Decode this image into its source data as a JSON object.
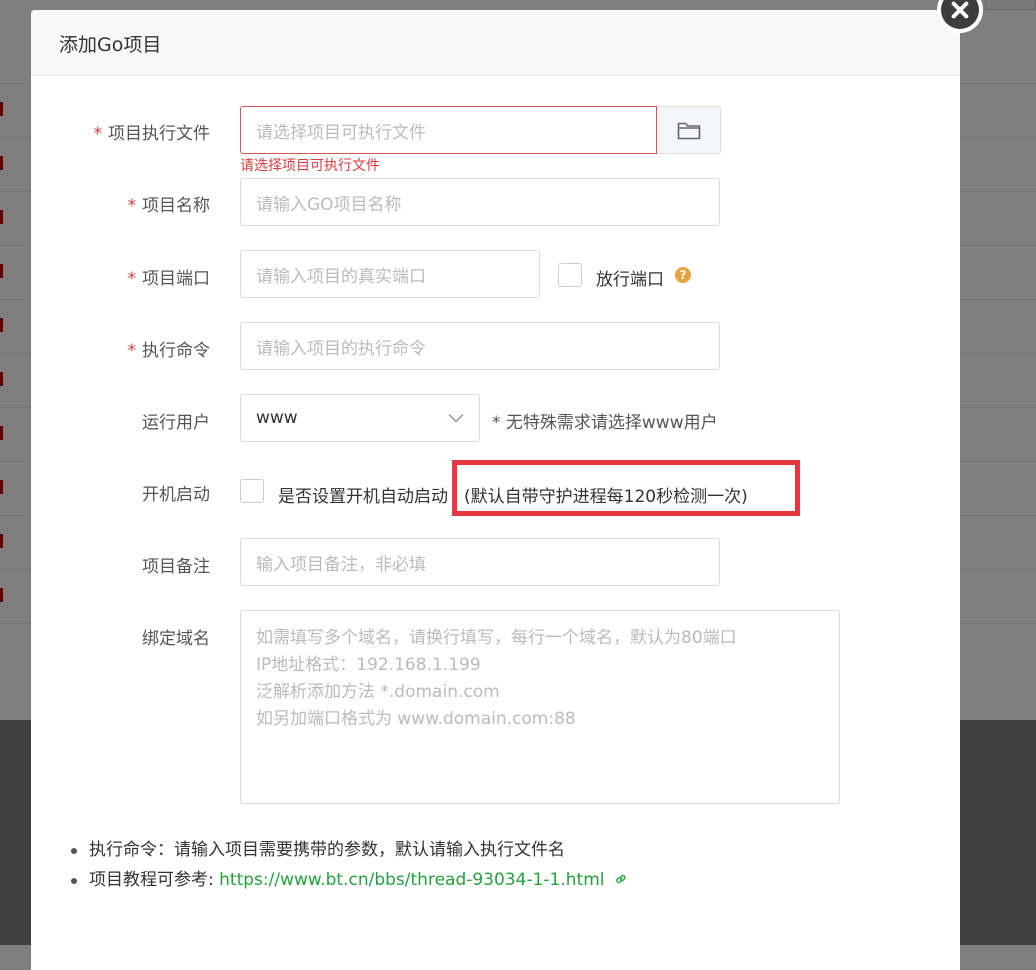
{
  "modal": {
    "title": "添加Go项目"
  },
  "form": {
    "exec_file": {
      "label": "项目执行文件",
      "placeholder": "请选择项目可执行文件",
      "error": "请选择项目可执行文件",
      "required": true
    },
    "project_name": {
      "label": "项目名称",
      "placeholder": "请输入GO项目名称",
      "required": true
    },
    "project_port": {
      "label": "项目端口",
      "placeholder": "请输入项目的真实端口",
      "required": true,
      "open_port_label": "放行端口",
      "help": "?"
    },
    "exec_command": {
      "label": "执行命令",
      "placeholder": "请输入项目的执行命令",
      "required": true
    },
    "run_user": {
      "label": "运行用户",
      "value": "www",
      "hint": "* 无特殊需求请选择www用户"
    },
    "autostart": {
      "label": "开机启动",
      "checkbox_label": "是否设置开机自动启动",
      "note": "(默认自带守护进程每120秒检测一次)"
    },
    "remark": {
      "label": "项目备注",
      "placeholder": "输入项目备注，非必填"
    },
    "domains": {
      "label": "绑定域名",
      "placeholder_lines": [
        "如需填写多个域名，请换行填写，每行一个域名，默认为80端口",
        "IP地址格式：192.168.1.199",
        "泛解析添加方法 *.domain.com",
        "如另加端口格式为 www.domain.com:88"
      ]
    }
  },
  "tips": {
    "tip1": "执行命令：请输入项目需要携带的参数，默认请输入执行文件名",
    "tip2_prefix": "项目教程可参考: ",
    "tip2_link": "https://www.bt.cn/bbs/thread-93034-1-1.html"
  },
  "colors": {
    "required": "#e0393e",
    "link": "#20a53a",
    "highlight": "#e8383d"
  }
}
